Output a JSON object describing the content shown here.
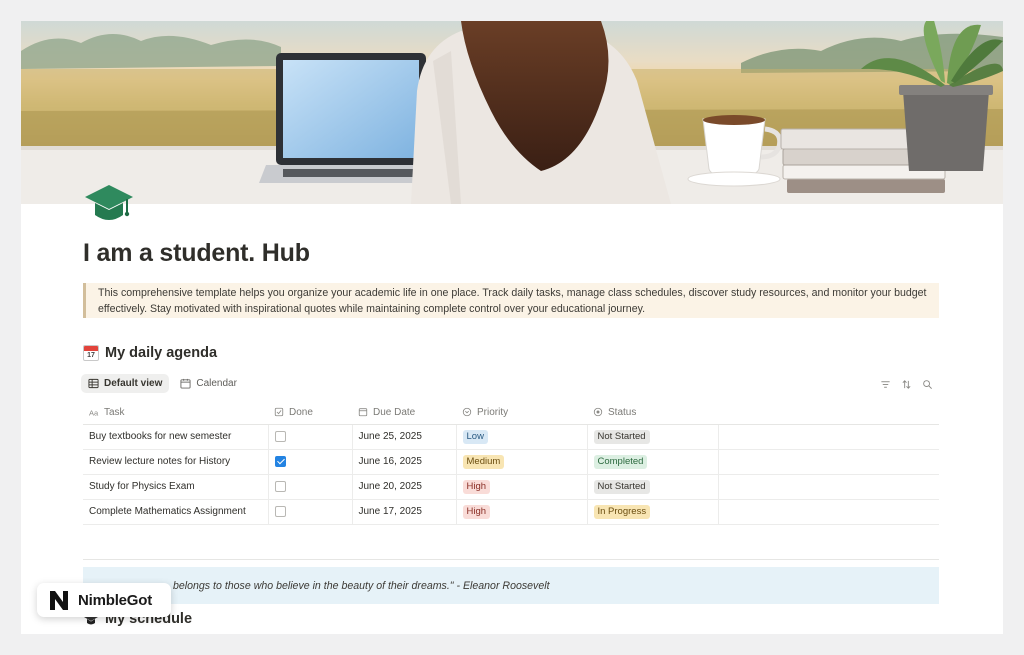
{
  "page": {
    "title": "I am a student. Hub",
    "icon": "graduation-cap-icon",
    "callout": "This comprehensive template helps you organize your academic life in one place. Track daily tasks, manage class schedules, discover study resources, and monitor your budget effectively. Stay motivated with inspirational quotes while maintaining complete control over your educational journey."
  },
  "agenda": {
    "heading": "My daily agenda",
    "heading_icon": "calendar-icon",
    "calendar_emoji_day": "17",
    "views": [
      {
        "label": "Default view",
        "icon": "table-icon",
        "active": true
      },
      {
        "label": "Calendar",
        "icon": "calendar-icon",
        "active": false
      }
    ],
    "tools": [
      "filter-icon",
      "sort-icon",
      "search-icon"
    ],
    "columns": [
      {
        "label": "Task",
        "icon": "text-property-icon"
      },
      {
        "label": "Done",
        "icon": "checkbox-property-icon"
      },
      {
        "label": "Due Date",
        "icon": "date-property-icon"
      },
      {
        "label": "Priority",
        "icon": "select-property-icon"
      },
      {
        "label": "Status",
        "icon": "status-property-icon"
      }
    ],
    "rows": [
      {
        "task": "Buy textbooks for new semester",
        "done": false,
        "due": "June 25, 2025",
        "priority": "Low",
        "status": "Not Started"
      },
      {
        "task": "Review lecture notes for History",
        "done": true,
        "due": "June 16, 2025",
        "priority": "Medium",
        "status": "Completed"
      },
      {
        "task": "Study for Physics Exam",
        "done": false,
        "due": "June 20, 2025",
        "priority": "High",
        "status": "Not Started"
      },
      {
        "task": "Complete Mathematics Assignment",
        "done": false,
        "due": "June 17, 2025",
        "priority": "High",
        "status": "In Progress"
      }
    ]
  },
  "tag_colors": {
    "Low": {
      "bg": "#d8e8f5",
      "fg": "#2a5a82"
    },
    "Medium": {
      "bg": "#f8e5b3",
      "fg": "#6b4e10"
    },
    "High": {
      "bg": "#f9dcd8",
      "fg": "#8a2f26"
    },
    "Not Started": {
      "bg": "#e7e7e5",
      "fg": "#37352f"
    },
    "Completed": {
      "bg": "#dcefe2",
      "fg": "#2c6a3f"
    },
    "In Progress": {
      "bg": "#f8e5b3",
      "fg": "#6b4e10"
    }
  },
  "quote": {
    "text": "belongs to those who believe in the beauty of their dreams.\" - Eleanor Roosevelt"
  },
  "schedule": {
    "heading": "My schedule"
  },
  "badge": {
    "label": "NimbleGot",
    "logo": "nimblegot-logo-icon"
  }
}
